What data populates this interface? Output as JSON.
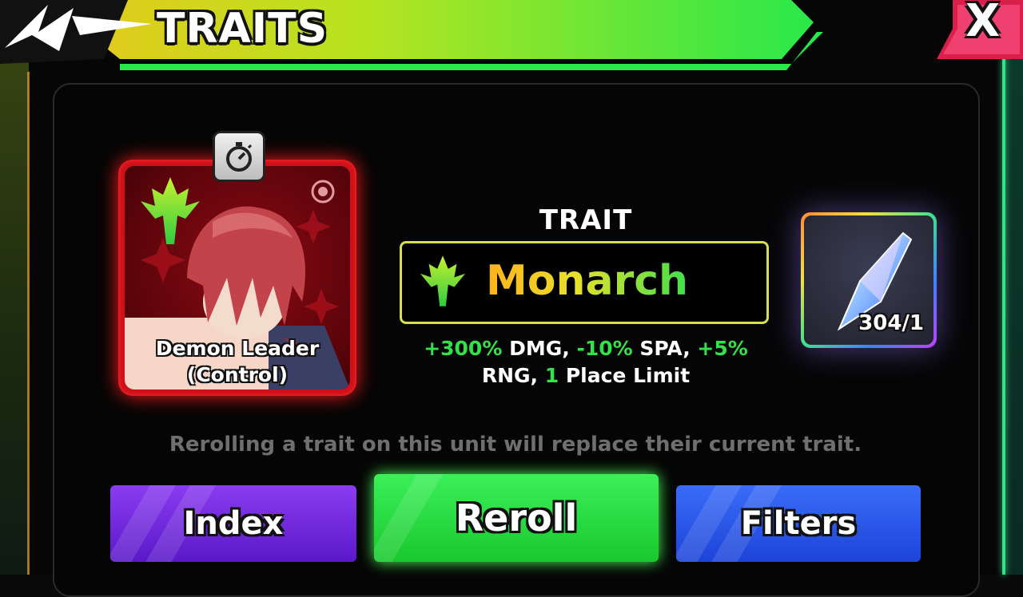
{
  "header": {
    "title": "TRAITS",
    "close_label": "X"
  },
  "unit": {
    "name_line1": "Demon Leader",
    "name_line2": "(Control)"
  },
  "trait": {
    "label": "TRAIT",
    "name": "Monarch",
    "desc_line1": [
      "+300%",
      " DMG, ",
      "-10%",
      " SPA, ",
      "+5%"
    ],
    "desc_line2": [
      "RNG, ",
      "1",
      " Place Limit"
    ]
  },
  "item": {
    "count": "304/1",
    "icon": "crystal-icon"
  },
  "warning": "Rerolling a trait on this unit will replace their current trait.",
  "buttons": {
    "index": "Index",
    "reroll": "Reroll",
    "filters": "Filters"
  },
  "colors": {
    "accent_green": "#33e24a",
    "unit_red": "#d0101a",
    "trait_border": "#d8de50",
    "index_purple": "#7a2ee8",
    "filters_blue": "#2a58ee"
  }
}
